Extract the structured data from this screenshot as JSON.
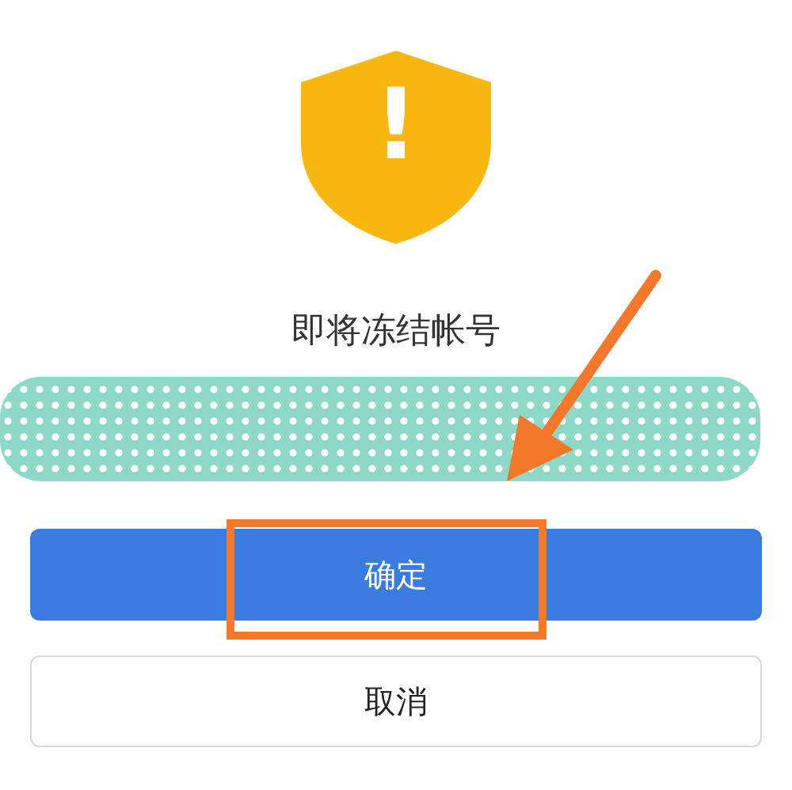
{
  "dialog": {
    "icon_mark": "!",
    "title": "即将冻结帐号"
  },
  "buttons": [
    {
      "label": "确定",
      "kind": "primary"
    },
    {
      "label": "取消",
      "kind": "secondary"
    }
  ]
}
